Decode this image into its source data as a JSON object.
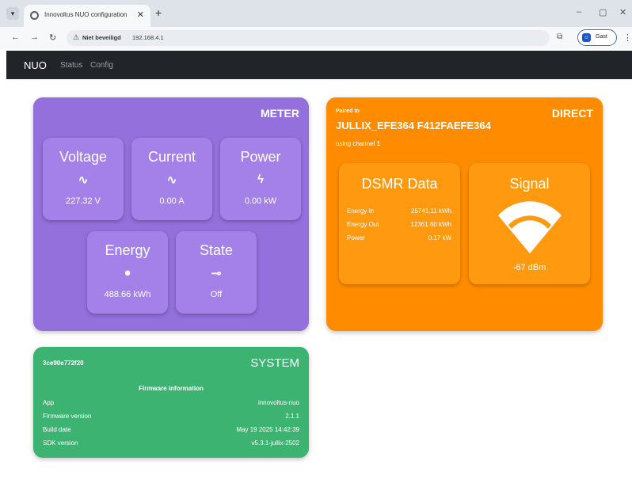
{
  "browser": {
    "tab_title": "Innovoltus NUO configuration",
    "security_label": "Niet beveiligd",
    "url": "192.168.4.1",
    "profile_label": "Gast"
  },
  "navbar": {
    "brand": "NUO",
    "links": [
      "Status",
      "Config"
    ]
  },
  "meter": {
    "title": "METER",
    "tiles": [
      {
        "label": "Voltage",
        "icon": "sine-wave-icon",
        "glyph": "∿",
        "value": "227.32 V"
      },
      {
        "label": "Current",
        "icon": "sine-wave-icon",
        "glyph": "∿",
        "value": "0.00 A"
      },
      {
        "label": "Power",
        "icon": "lightning-icon",
        "glyph": "ϟ",
        "value": "0.00 kW"
      },
      {
        "label": "Energy",
        "icon": "energy-icon",
        "glyph": "●",
        "value": "488.66 kWh"
      },
      {
        "label": "State",
        "icon": "switch-icon",
        "glyph": "⊸",
        "value": "Off"
      }
    ]
  },
  "direct": {
    "title": "DIRECT",
    "paired_label": "Paired to",
    "paired_value": "JULLIX_EFE364 F412FAEFE364",
    "channel_prefix": "using channel",
    "channel": "1",
    "dsmr": {
      "title": "DSMR Data",
      "rows": [
        {
          "key": "Energy In",
          "value": "25741.11 kWh"
        },
        {
          "key": "Energy Out",
          "value": "12361.60 kWh"
        },
        {
          "key": "Power",
          "value": "0.17 kW"
        }
      ]
    },
    "signal": {
      "title": "Signal",
      "value": "-67 dBm"
    }
  },
  "system": {
    "title": "SYSTEM",
    "id": "3ce90e772f20",
    "firmware_heading": "Firmware information",
    "rows": [
      {
        "key": "App",
        "value": "innovoltus-nuo"
      },
      {
        "key": "Firmware version",
        "value": "2.1.1"
      },
      {
        "key": "Build date",
        "value": "May 19 2025 14:42:39"
      },
      {
        "key": "SDK version",
        "value": "v5.3.1-jullix-2502"
      }
    ]
  },
  "colors": {
    "meter": "#9370db",
    "direct": "#ff8c00",
    "system": "#3cb371",
    "navbar": "#212529"
  }
}
